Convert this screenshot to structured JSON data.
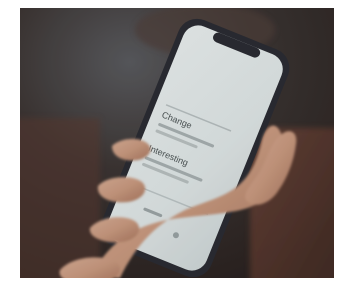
{
  "photo": {
    "subject": "hand-holding-phone",
    "colors": {
      "background_dark": "#3a3431",
      "background_warm": "#7a4a3a",
      "phone_frame": "#2b2c33",
      "screen": "#dfe6e6",
      "skin": "#c99a80",
      "shadow": "#6d4f45"
    }
  },
  "phone_screen": {
    "heading_1": "Change",
    "heading_2": "Interesting"
  }
}
